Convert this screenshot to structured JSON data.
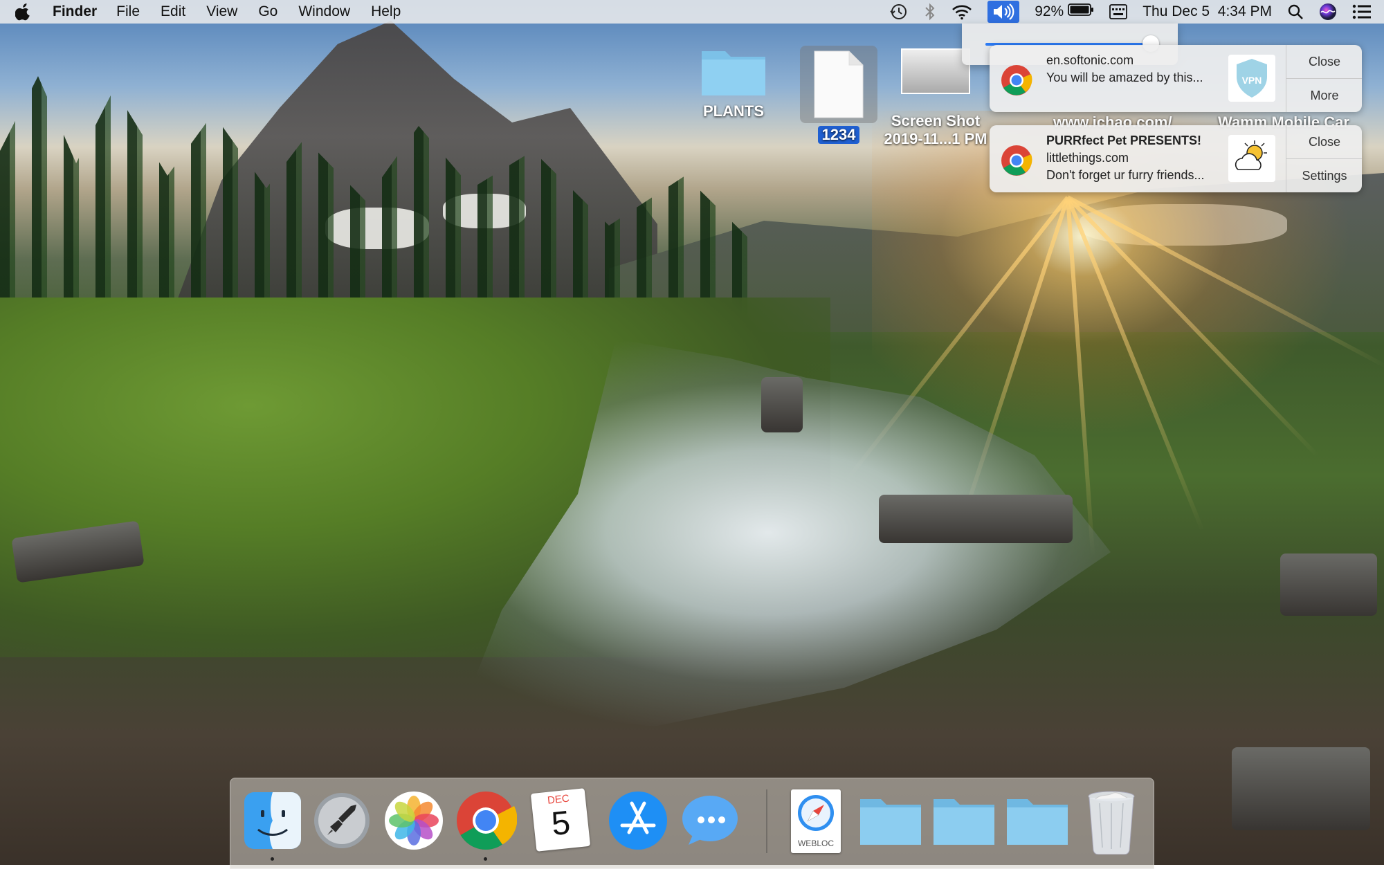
{
  "menubar": {
    "app_name": "Finder",
    "menus": [
      "File",
      "Edit",
      "View",
      "Go",
      "Window",
      "Help"
    ],
    "battery_percent": "92%",
    "datetime": "Thu Dec 5  4:34 PM",
    "icons": [
      "apple-icon",
      "time-machine-icon",
      "bluetooth-icon",
      "wifi-icon",
      "volume-icon",
      "battery-icon",
      "input-menu-icon",
      "spotlight-icon",
      "siri-icon",
      "notification-center-icon"
    ]
  },
  "volume": {
    "level": 0.98
  },
  "notifications": [
    {
      "title": "",
      "subtitle": "en.softonic.com",
      "body": "You will be amazed by this...",
      "thumb_label": "VPN",
      "action_primary": "Close",
      "action_secondary": "More"
    },
    {
      "title": "PURRfect Pet PRESENTS!",
      "subtitle": "littlethings.com",
      "body": "Don't forget ur furry friends...",
      "thumb_label": "",
      "action_primary": "Close",
      "action_secondary": "Settings"
    }
  ],
  "desktop": {
    "plants_label": "PLANTS",
    "file_label": "1234",
    "screenshot_label_line1": "Screen Shot",
    "screenshot_label_line2": "2019-11...1 PM",
    "partial_label_1": "www.ichao.com/",
    "partial_label_2": "Wamm Mobile Car"
  },
  "dock": {
    "calendar_month": "DEC",
    "calendar_day": "5",
    "webloc_label": "WEBLOC",
    "colors": {
      "chrome_red": "#db4437",
      "chrome_green": "#0f9d58",
      "chrome_yellow": "#f4b400",
      "chrome_blue": "#4285f4",
      "folder_blue": "#7fc3ea"
    }
  }
}
